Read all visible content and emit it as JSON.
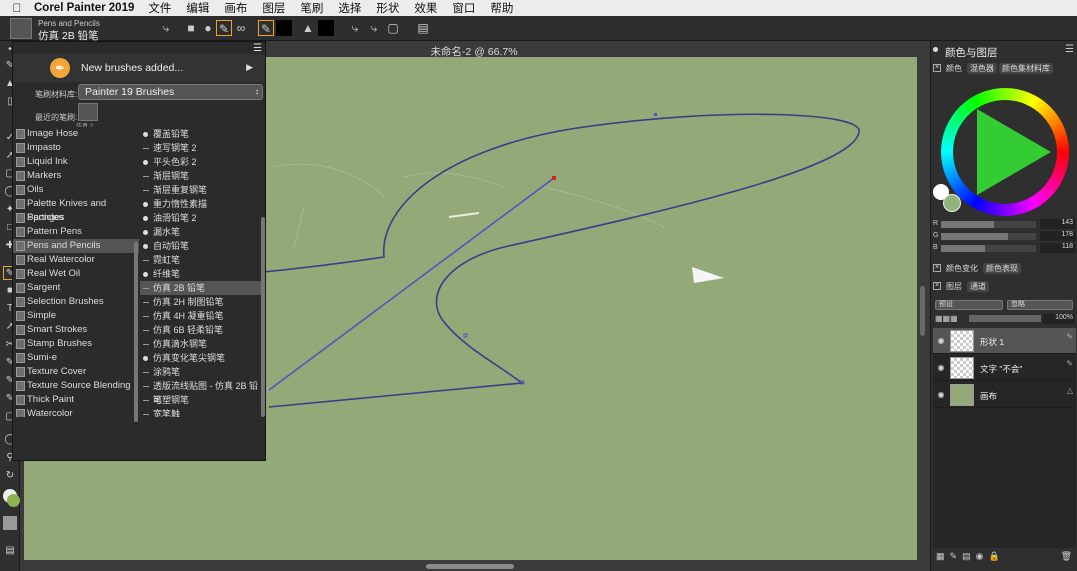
{
  "menubar": {
    "app_name": "Corel Painter 2019",
    "items": [
      "文件",
      "编辑",
      "画布",
      "图层",
      "笔刷",
      "选择",
      "形状",
      "效果",
      "窗口",
      "帮助"
    ]
  },
  "propbar": {
    "brush_category": "Pens and Pencils",
    "brush_name": "仿真 2B 铅笔"
  },
  "document": {
    "title": "未命名-2 @ 66.7%"
  },
  "brush_popup": {
    "notice": "New brushes added...",
    "library_label": "笔刷材料库:",
    "library_value": "Painter 19 Brushes",
    "recent_label": "最近的笔刷:",
    "recent_brush": "仿真 2...",
    "categories": [
      {
        "name": "Image Hose",
        "selected": false
      },
      {
        "name": "Impasto",
        "selected": false
      },
      {
        "name": "Liquid Ink",
        "selected": false
      },
      {
        "name": "Markers",
        "selected": false
      },
      {
        "name": "Oils",
        "selected": false
      },
      {
        "name": "Palette Knives and Sponges",
        "selected": false
      },
      {
        "name": "Particles",
        "selected": false
      },
      {
        "name": "Pattern Pens",
        "selected": false
      },
      {
        "name": "Pens and Pencils",
        "selected": true
      },
      {
        "name": "Real Watercolor",
        "selected": false
      },
      {
        "name": "Real Wet Oil",
        "selected": false
      },
      {
        "name": "Sargent",
        "selected": false
      },
      {
        "name": "Selection Brushes",
        "selected": false
      },
      {
        "name": "Simple",
        "selected": false
      },
      {
        "name": "Smart Strokes",
        "selected": false
      },
      {
        "name": "Stamp Brushes",
        "selected": false
      },
      {
        "name": "Sumi-e",
        "selected": false
      },
      {
        "name": "Texture Cover",
        "selected": false
      },
      {
        "name": "Texture Source Blending",
        "selected": false
      },
      {
        "name": "Thick Paint",
        "selected": false
      },
      {
        "name": "Watercolor",
        "selected": false
      }
    ],
    "variants": [
      {
        "name": "覆盖铅笔",
        "dot": "round",
        "selected": false
      },
      {
        "name": "速写钢笔 2",
        "dot": "line",
        "selected": false
      },
      {
        "name": "平头色彩 2",
        "dot": "round",
        "selected": false
      },
      {
        "name": "渐层钢笔",
        "dot": "line",
        "selected": false
      },
      {
        "name": "渐层重复钢笔",
        "dot": "line",
        "selected": false
      },
      {
        "name": "重力惰性素描",
        "dot": "round",
        "selected": false
      },
      {
        "name": "油滑铅笔 2",
        "dot": "round",
        "selected": false
      },
      {
        "name": "漏水笔",
        "dot": "round",
        "selected": false
      },
      {
        "name": "自动铅笔",
        "dot": "round",
        "selected": false
      },
      {
        "name": "霓虹笔",
        "dot": "line",
        "selected": false
      },
      {
        "name": "纤维笔",
        "dot": "round",
        "selected": false
      },
      {
        "name": "仿真 2B 铅笔",
        "dot": "line",
        "selected": true
      },
      {
        "name": "仿真 2H 制图铅笔",
        "dot": "line",
        "selected": false
      },
      {
        "name": "仿真 4H 凝重铅笔",
        "dot": "line",
        "selected": false
      },
      {
        "name": "仿真 6B 轻柔铅笔",
        "dot": "line",
        "selected": false
      },
      {
        "name": "仿真滴水钢笔",
        "dot": "line",
        "selected": false
      },
      {
        "name": "仿真变化笔尖钢笔",
        "dot": "round",
        "selected": false
      },
      {
        "name": "涂鸦笔",
        "dot": "line",
        "selected": false
      },
      {
        "name": "透版流线贴图 - 仿真 2B 铅笔",
        "dot": "line",
        "selected": false
      },
      {
        "name": "可塑钢笔",
        "dot": "line",
        "selected": false
      },
      {
        "name": "宽笔触",
        "dot": "line",
        "selected": false
      }
    ]
  },
  "right_panel": {
    "title": "颜色与图层",
    "color_tabs": [
      "颜色",
      "混色器",
      "颜色集材料库"
    ],
    "rgb": [
      {
        "label": "R",
        "value": 143
      },
      {
        "label": "G",
        "value": 178
      },
      {
        "label": "B",
        "value": 118
      }
    ],
    "sub_tabs": [
      "颜色变化",
      "颜色表现"
    ],
    "layer_tabs": [
      "图层",
      "通道"
    ],
    "composite_method": "预设",
    "composite_depth": "忽略",
    "opacity": "100%",
    "layers": [
      {
        "name": "形状 1",
        "type": "transparent",
        "selected": true
      },
      {
        "name": "文字 \"不会\"",
        "type": "transparent",
        "selected": false
      },
      {
        "name": "画布",
        "type": "canvas",
        "selected": false
      }
    ]
  },
  "colors": {
    "canvas": "#93a978",
    "shape_stroke": "#3a3e8a",
    "selected_line": "#5054c0",
    "current_color": "#8fb24f"
  }
}
